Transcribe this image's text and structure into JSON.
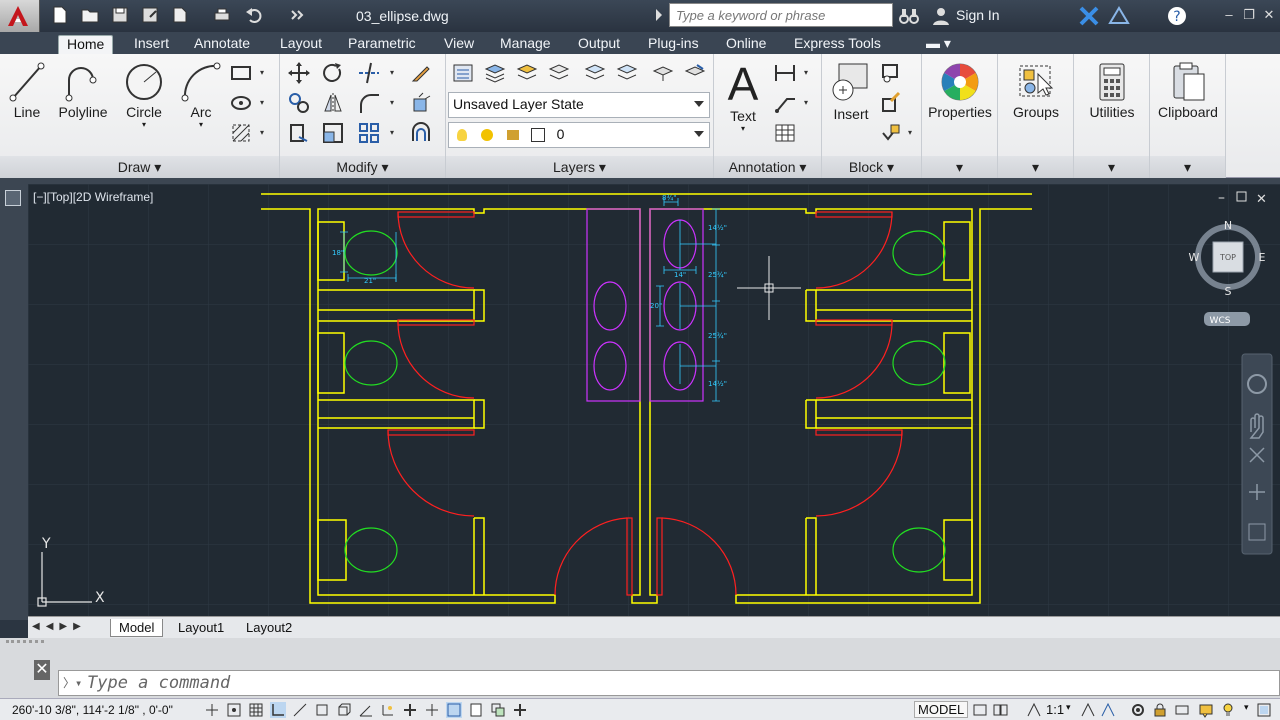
{
  "title_bar": {
    "document": "03_ellipse.dwg",
    "search_placeholder": "Type a keyword or phrase",
    "signin": "Sign In"
  },
  "tabs": [
    "Home",
    "Insert",
    "Annotate",
    "Layout",
    "Parametric",
    "View",
    "Manage",
    "Output",
    "Plug-ins",
    "Online",
    "Express Tools"
  ],
  "ribbon": {
    "draw": {
      "footer": "Draw",
      "line": "Line",
      "polyline": "Polyline",
      "circle": "Circle",
      "arc": "Arc"
    },
    "modify": {
      "footer": "Modify"
    },
    "layers": {
      "footer": "Layers",
      "layer_state": "Unsaved Layer State",
      "layer_current": "0"
    },
    "annotation": {
      "footer": "Annotation",
      "text": "Text"
    },
    "block": {
      "footer": "Block",
      "insert": "Insert"
    },
    "properties": "Properties",
    "groups": "Groups",
    "utilities": "Utilities",
    "clipboard": "Clipboard"
  },
  "viewport": {
    "label": "[−][Top][2D Wireframe]",
    "viewcube": {
      "n": "N",
      "s": "S",
      "e": "E",
      "w": "W",
      "top": "TOP",
      "wcs": "WCS"
    },
    "ucs": {
      "x": "X",
      "y": "Y"
    },
    "dims": {
      "d1": "18\"",
      "d2": "21\"",
      "d3": "14½\"",
      "d4": "14\"",
      "d5": "25¾\"",
      "d6": "20\"",
      "d7": "25¾\"",
      "d8": "14½\"",
      "d9": "8¾\""
    }
  },
  "layout_tabs": [
    "Model",
    "Layout1",
    "Layout2"
  ],
  "command": {
    "placeholder": "Type a command"
  },
  "status": {
    "coords": "260'-10 3/8\", 114'-2 1/8\" , 0'-0\"",
    "model": "MODEL",
    "scale": "1:1"
  },
  "colors": {
    "wall": "#ffff00",
    "door": "#ff2020",
    "fixture": "#22dd22",
    "sink": "#cc33ff",
    "dim": "#33ccff",
    "grid": "#2e3945"
  }
}
